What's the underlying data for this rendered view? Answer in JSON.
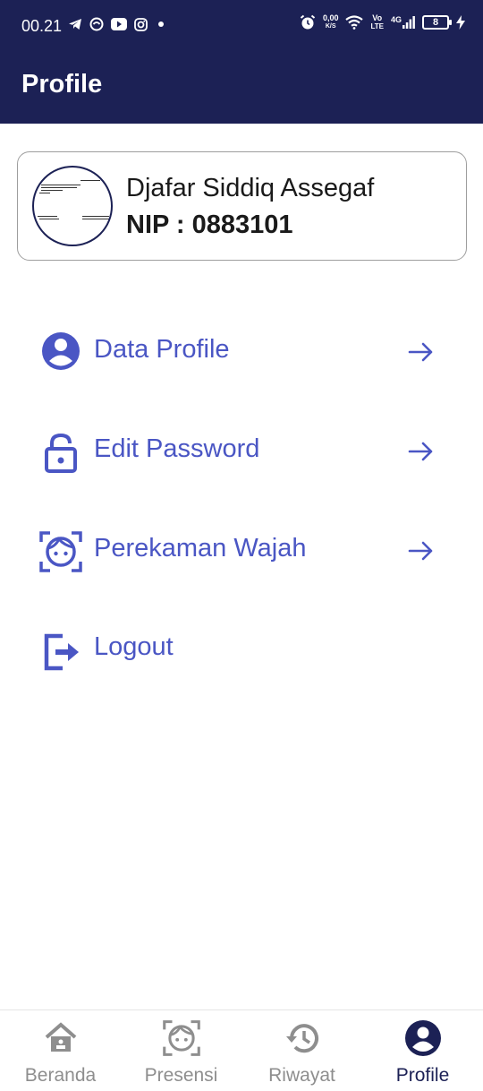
{
  "status_bar": {
    "time": "00.21",
    "net_speed_top": "0,00",
    "net_speed_bottom": "K/S",
    "volte_top": "Vo",
    "volte_bottom": "LTE",
    "network": "4G",
    "battery": "8",
    "left_icons": [
      "telegram-icon",
      "bubble-icon",
      "youtube-icon",
      "instagram-icon",
      "dot-icon"
    ],
    "right_icons": [
      "alarm-icon",
      "wifi-icon",
      "signal-icon",
      "charging-icon"
    ]
  },
  "appbar": {
    "title": "Profile"
  },
  "profile": {
    "name": "Djafar Siddiq Assegaf",
    "nip": "NIP : 0883101"
  },
  "menu": [
    {
      "label": "Data Profile",
      "icon": "account-circle-icon",
      "has_arrow": true
    },
    {
      "label": "Edit Password",
      "icon": "lock-open-icon",
      "has_arrow": true
    },
    {
      "label": "Perekaman Wajah",
      "icon": "face-scan-icon",
      "has_arrow": true
    },
    {
      "label": "Logout",
      "icon": "logout-icon",
      "has_arrow": false
    }
  ],
  "bottom_nav": [
    {
      "label": "Beranda",
      "icon": "home-icon",
      "active": false
    },
    {
      "label": "Presensi",
      "icon": "face-scan-icon",
      "active": false
    },
    {
      "label": "Riwayat",
      "icon": "history-icon",
      "active": false
    },
    {
      "label": "Profile",
      "icon": "account-circle-icon",
      "active": true
    }
  ],
  "colors": {
    "appbar": "#1c2155",
    "accent": "#4a56c4",
    "inactive": "#8e8e8e",
    "active_nav": "#1c2155"
  }
}
